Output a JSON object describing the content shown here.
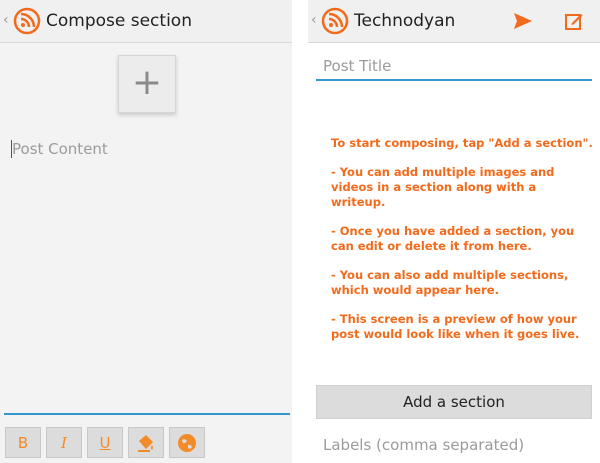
{
  "left": {
    "header": {
      "up_caret": "‹",
      "title": "Compose section",
      "logo_icon": "blogger-wifi-icon"
    },
    "add_button": {
      "symbol": "+"
    },
    "editor": {
      "placeholder": "Post Content"
    },
    "format_toolbar": {
      "bold": "B",
      "italic": "I",
      "underline": "U",
      "color_icon": "paint-bucket-icon",
      "link_icon": "globe-icon"
    }
  },
  "right": {
    "header": {
      "up_caret": "‹",
      "title": "Technodyan",
      "send_icon": "send-icon",
      "edit_icon": "edit-icon"
    },
    "post_title_placeholder": "Post Title",
    "help_text": [
      "To start composing, tap \"Add a section\".",
      "- You can add multiple images and videos in a section along with a writeup.",
      "- Once you have added a section, you can edit or delete it from here.",
      "- You can also add multiple sections, which would appear here.",
      "- This screen is a preview of how your post would look like when it goes live."
    ],
    "add_section_label": "Add a section",
    "labels_placeholder": "Labels (comma separated)"
  },
  "colors": {
    "accent": "#f26a1b",
    "focus_line": "#3399cc"
  }
}
